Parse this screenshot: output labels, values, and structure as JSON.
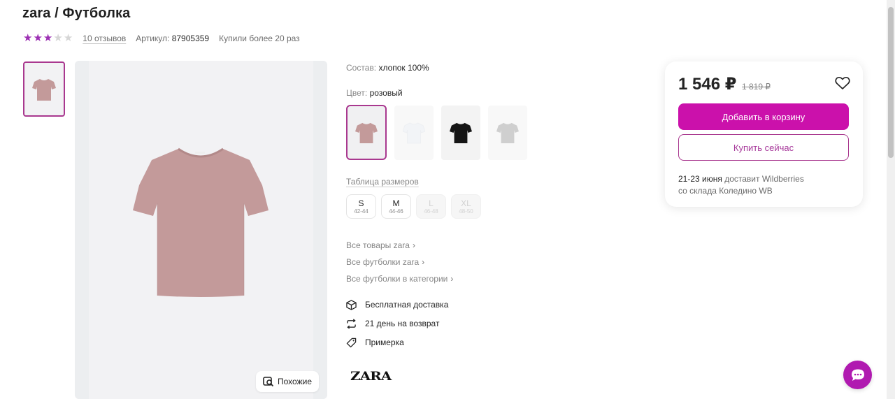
{
  "product": {
    "title": "zara / Футболка",
    "rating": 3,
    "rating_max": 5,
    "reviews_label": "10 отзывов",
    "article_label": "Артикул:",
    "article_value": "87905359",
    "purchased_label": "Купили более 20 раз"
  },
  "gallery": {
    "similar_label": "Похожие",
    "icon": "similar-search-icon"
  },
  "details": {
    "composition_label": "Состав:",
    "composition_value": "хлопок 100%",
    "color_label": "Цвет:",
    "color_value": "розовый",
    "color_options": [
      {
        "name": "pink",
        "hex": "#c39a9a"
      },
      {
        "name": "white",
        "hex": "#f4f5f7"
      },
      {
        "name": "black",
        "hex": "#151515"
      },
      {
        "name": "grey",
        "hex": "#c9c9c9"
      }
    ],
    "size_table_label": "Таблица размеров",
    "sizes": [
      {
        "name": "S",
        "range": "42-44",
        "available": true
      },
      {
        "name": "M",
        "range": "44-46",
        "available": true
      },
      {
        "name": "L",
        "range": "46-48",
        "available": false
      },
      {
        "name": "XL",
        "range": "48-50",
        "available": false
      }
    ],
    "links": [
      "Все товары zara",
      "Все футболки zara",
      "Все футболки в категории"
    ],
    "features": [
      {
        "label": "Бесплатная доставка",
        "icon": "box-icon"
      },
      {
        "label": "21 день на возврат",
        "icon": "return-arrows-icon"
      },
      {
        "label": "Примерка",
        "icon": "tag-icon"
      }
    ],
    "brand_logo": "ZARA"
  },
  "buybox": {
    "price": "1 546 ₽",
    "old_price": "1 819 ₽",
    "add_to_cart": "Добавить в корзину",
    "buy_now": "Купить сейчас",
    "delivery_date": "21-23 июня",
    "delivery_text": " доставит Wildberries",
    "delivery_warehouse": "со склада Коледино WB"
  },
  "colors": {
    "accent": "#cb11ab",
    "accent_border": "#a9388f",
    "star": "#9c2fb3",
    "chat": "#b01ab0",
    "product_pink": "#c39a9a"
  }
}
